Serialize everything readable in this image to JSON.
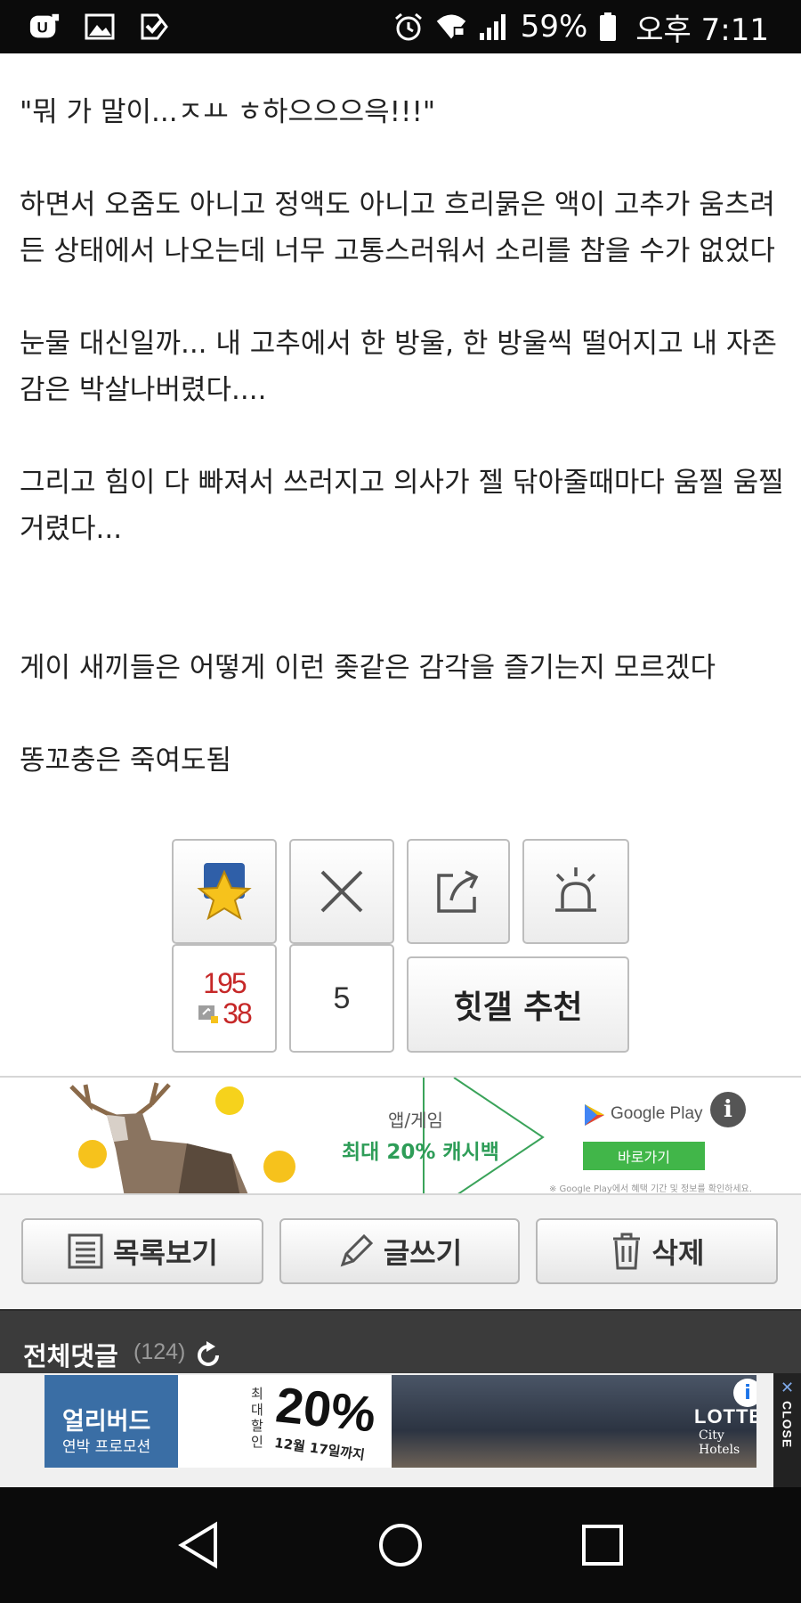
{
  "status_bar": {
    "battery": "59%",
    "time": "오후 7:11",
    "icons": [
      "uplus-icon",
      "image-notification-icon",
      "check-notification-icon",
      "alarm-icon",
      "wifi-lock-icon",
      "signal-icon",
      "battery-icon"
    ]
  },
  "article": {
    "paragraphs": [
      "\"뭐 가 말이...ㅈㅛ ㅎ하으으으윽!!!\"",
      "하면서 오줌도 아니고 정액도 아니고 흐리묽은 액이 고추가 움츠려든 상태에서 나오는데 너무 고통스러워서 소리를 참을 수가 없었다",
      "눈물 대신일까... 내 고추에서 한 방울, 한 방울씩 떨어지고 내 자존감은 박살나버렸다....",
      "그리고 힘이 다 빠져서 쓰러지고 의사가 젤 닦아줄때마다 움찔 움찔거렸다...",
      "게이 새끼들은 어떻게 이런 좆같은 감각을 즐기는지 모르겠다",
      "똥꼬충은 죽여도됨"
    ]
  },
  "recommend": {
    "up_count": "195",
    "fixed_count": "38",
    "down_count": "5",
    "hit_label": "힛갤 추천"
  },
  "ad_banner": {
    "line1": "앱/게임",
    "line2": "최대 20% 캐시백",
    "store": "Google Play",
    "cta": "바로가기",
    "note": "※ Google Play에서 혜택 기간 및 정보를 확인하세요.",
    "info": "i"
  },
  "actions": {
    "list": "목록보기",
    "write": "글쓰기",
    "delete": "삭제"
  },
  "comments": {
    "title": "전체댓글",
    "count": "(124)"
  },
  "bottom_ad": {
    "title": "얼리버드",
    "subtitle": "연박 프로모션",
    "badge": "최대 할인",
    "percent": "20%",
    "until": "12월 17일까지",
    "brand": "LOTTE",
    "brand_sub": "City Hotels",
    "close_label": "CLOSE"
  },
  "colors": {
    "red_count": "#c62828",
    "ad_green": "#41b649",
    "comment_header": "#3b3b3b"
  }
}
